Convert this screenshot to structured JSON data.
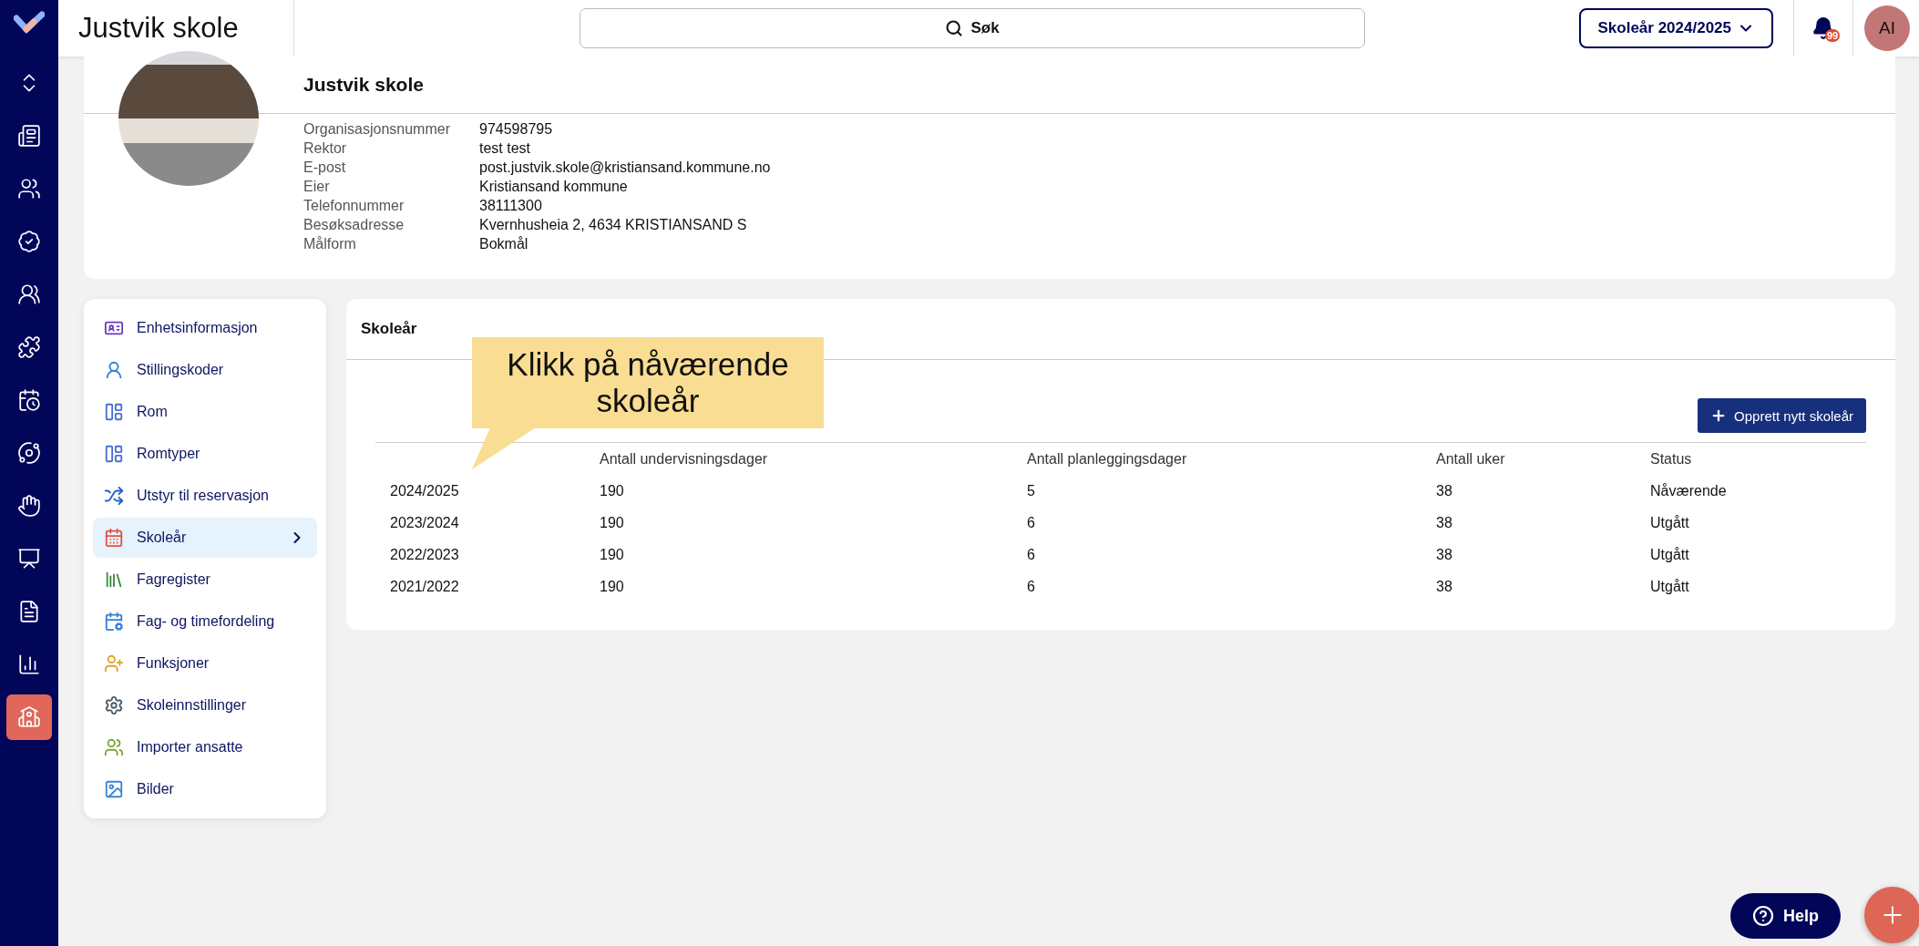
{
  "nav_rail": {
    "items": [
      {
        "selected": false
      },
      {
        "selected": false
      },
      {
        "selected": false
      },
      {
        "selected": false
      },
      {
        "selected": false
      },
      {
        "selected": false
      },
      {
        "selected": false
      },
      {
        "selected": false
      },
      {
        "selected": false
      },
      {
        "selected": false
      },
      {
        "selected": false
      },
      {
        "selected": false
      },
      {
        "selected": true
      }
    ]
  },
  "header": {
    "title": "Justvik skole",
    "search": {
      "placeholder": "Søk"
    },
    "school_year_button": "Skoleår 2024/2025",
    "notification_count": "99",
    "avatar": "AI"
  },
  "school_info": {
    "name": "Justvik skole",
    "fields": [
      {
        "label": "Organisasjonsnummer",
        "value": "974598795"
      },
      {
        "label": "Rektor",
        "value": "test test"
      },
      {
        "label": "E-post",
        "value": "post.justvik.skole@kristiansand.kommune.no"
      },
      {
        "label": "Eier",
        "value": "Kristiansand kommune"
      },
      {
        "label": "Telefonnummer",
        "value": "38111300"
      },
      {
        "label": "Besøksadresse",
        "value": "Kvernhusheia 2, 4634 KRISTIANSAND S"
      },
      {
        "label": "Målform",
        "value": "Bokmål"
      }
    ]
  },
  "menu": {
    "items": [
      {
        "label": "Enhetsinformasjon",
        "selected": false
      },
      {
        "label": "Stillingskoder",
        "selected": false
      },
      {
        "label": "Rom",
        "selected": false
      },
      {
        "label": "Romtyper",
        "selected": false
      },
      {
        "label": "Utstyr til reservasjon",
        "selected": false
      },
      {
        "label": "Skoleår",
        "selected": true
      },
      {
        "label": "Fagregister",
        "selected": false
      },
      {
        "label": "Fag- og timefordeling",
        "selected": false
      },
      {
        "label": "Funksjoner",
        "selected": false
      },
      {
        "label": "Skoleinnstillinger",
        "selected": false
      },
      {
        "label": "Importer ansatte",
        "selected": false
      },
      {
        "label": "Bilder",
        "selected": false
      }
    ]
  },
  "panel": {
    "title": "Skoleår",
    "callout": "Klikk på nåværende skoleår",
    "create_button": "Opprett nytt skoleår",
    "table": {
      "columns": [
        "",
        "Antall undervisningsdager",
        "Antall planleggingsdager",
        "Antall uker",
        "Status"
      ],
      "rows": [
        [
          "2024/2025",
          "190",
          "5",
          "38",
          "Nåværende"
        ],
        [
          "2023/2024",
          "190",
          "6",
          "38",
          "Utgått"
        ],
        [
          "2022/2023",
          "190",
          "6",
          "38",
          "Utgått"
        ],
        [
          "2021/2022",
          "190",
          "6",
          "38",
          "Utgått"
        ]
      ]
    }
  },
  "help_button": "Help"
}
